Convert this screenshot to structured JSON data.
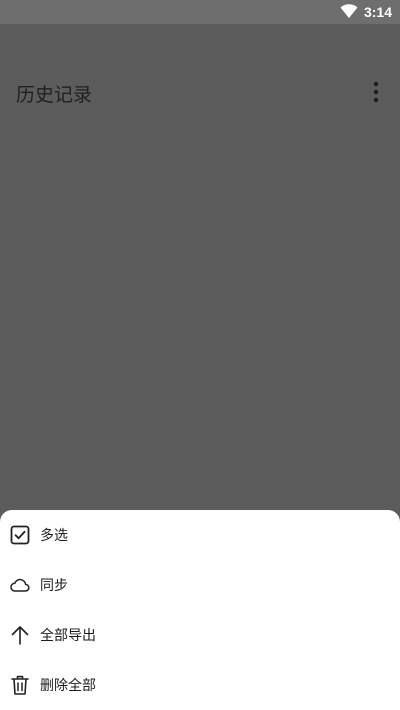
{
  "status_bar": {
    "time": "3:14",
    "wifi_icon": "wifi-icon"
  },
  "app_bar": {
    "title": "历史记录",
    "more_icon": "more-vert-icon"
  },
  "bottom_sheet": {
    "items": [
      {
        "label": "多选",
        "icon": "checkbox-checked-icon"
      },
      {
        "label": "同步",
        "icon": "cloud-icon"
      },
      {
        "label": "全部导出",
        "icon": "arrow-up-icon"
      },
      {
        "label": "删除全部",
        "icon": "trash-icon"
      }
    ]
  },
  "colors": {
    "scrim": "#5c5c5c",
    "status_bar": "#6e6e6e",
    "sheet": "#ffffff",
    "text": "#1c1c1c"
  }
}
